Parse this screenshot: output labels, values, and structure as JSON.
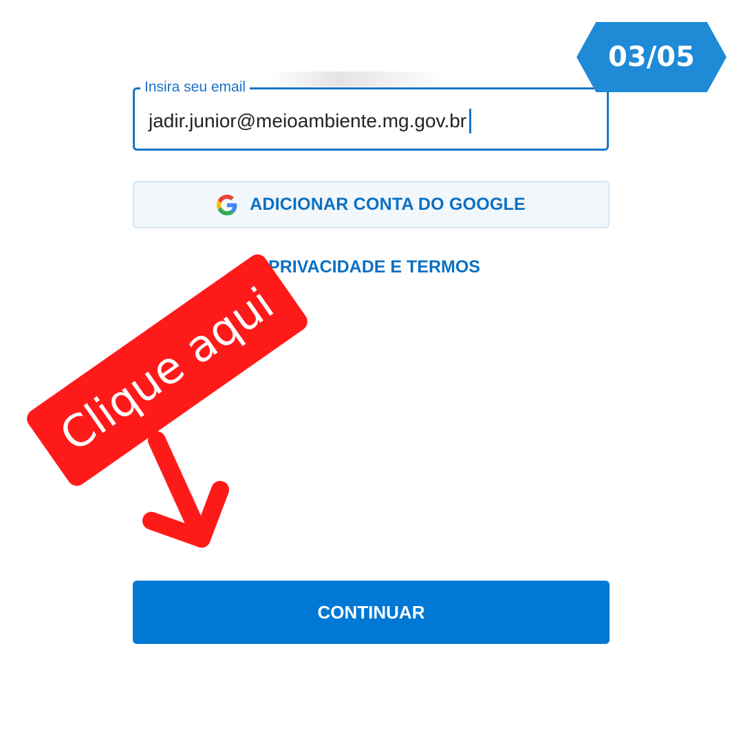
{
  "step_badge": {
    "text": "03/05",
    "color": "#1f8ad6"
  },
  "email_field": {
    "label": "Insira seu email",
    "value": "jadir.junior@meioambiente.mg.gov.br",
    "border_color": "#1a73c8"
  },
  "google_button": {
    "icon": "google-g-icon",
    "label": "ADICIONAR CONTA DO GOOGLE"
  },
  "privacy_link": {
    "label": "PRIVACIDADE E TERMOS"
  },
  "continue_button": {
    "label": "CONTINUAR",
    "color": "#0078d4"
  },
  "annotation": {
    "text": "Clique aqui",
    "color": "#ff1a1a",
    "arrow_icon": "arrow-down-icon"
  }
}
